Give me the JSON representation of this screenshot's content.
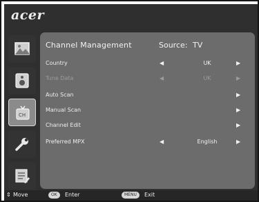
{
  "brand": "acer",
  "menu": {
    "title": "Channel Management",
    "source_label": "Source:",
    "source_value": "TV",
    "arrow_left": "◀",
    "arrow_right": "▶",
    "rows": [
      {
        "label": "Country",
        "value": "UK"
      },
      {
        "label": "Tune Data",
        "value": "UK"
      },
      {
        "label": "Auto Scan"
      },
      {
        "label": "Manual Scan"
      },
      {
        "label": "Channel Edit"
      },
      {
        "label": "Preferred MPX",
        "value": "English"
      }
    ]
  },
  "sidebar_icons": [
    "picture-icon",
    "audio-icon",
    "channel-icon",
    "settings-icon",
    "list-icon"
  ],
  "footer": {
    "move_arrows": "⇕",
    "move": "Move",
    "ok_key": "OK",
    "enter": "Enter",
    "menu_key": "MENU",
    "exit": "Exit"
  },
  "colors": {
    "panel": "#6c6c6c",
    "background": "#2f2f2f",
    "selected_tab": "#8b8b8b"
  }
}
